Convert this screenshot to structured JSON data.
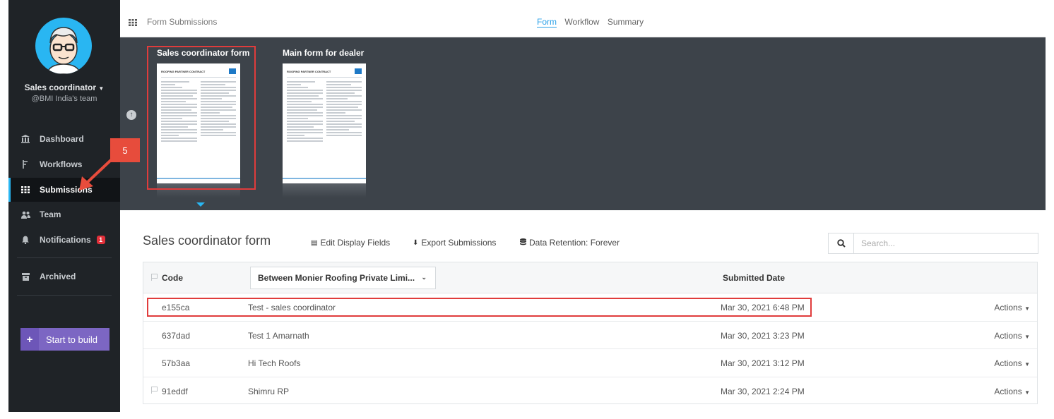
{
  "sidebar": {
    "user_name": "Sales coordinator",
    "user_team": "@BMI India's team",
    "items": [
      {
        "label": "Dashboard",
        "icon": "bank-icon"
      },
      {
        "label": "Workflows",
        "icon": "workflow-icon"
      },
      {
        "label": "Submissions",
        "icon": "grid-icon",
        "active": true
      },
      {
        "label": "Team",
        "icon": "users-icon"
      },
      {
        "label": "Notifications",
        "icon": "bell-icon",
        "badge": "1"
      },
      {
        "label": "Archived",
        "icon": "archive-icon"
      }
    ],
    "build_button": "Start to build"
  },
  "header": {
    "breadcrumb": "Form Submissions",
    "tabs": [
      "Form",
      "Workflow",
      "Summary"
    ],
    "active_tab": "Form"
  },
  "forms": [
    {
      "title": "Sales coordinator form",
      "doc_title": "ROOFING PARTNER CONTRACT",
      "selected": true
    },
    {
      "title": "Main form for dealer",
      "doc_title": "ROOFING PARTNER CONTRACT",
      "selected": false
    }
  ],
  "annotation": {
    "step": "5"
  },
  "submissions": {
    "form_name": "Sales coordinator form",
    "edit_fields": "Edit Display Fields",
    "export": "Export Submissions",
    "retention": "Data Retention: Forever",
    "search_placeholder": "Search...",
    "columns": {
      "code": "Code",
      "field": "Between Monier Roofing Private Limi...",
      "date": "Submitted Date"
    },
    "rows": [
      {
        "code": "e155ca",
        "name": "Test - sales coordinator",
        "date": "Mar 30, 2021 6:48 PM",
        "actions": "Actions"
      },
      {
        "code": "637dad",
        "name": "Test 1 Amarnath",
        "date": "Mar 30, 2021 3:23 PM",
        "actions": "Actions"
      },
      {
        "code": "57b3aa",
        "name": "Hi Tech Roofs",
        "date": "Mar 30, 2021 3:12 PM",
        "actions": "Actions"
      },
      {
        "code": "91eddf",
        "name": "Shimru RP",
        "date": "Mar 30, 2021 2:24 PM",
        "actions": "Actions"
      }
    ]
  },
  "colors": {
    "sidebar_bg": "#1f2327",
    "accent": "#29b6f2",
    "build_button": "#7c66c3",
    "highlight": "#e03c3c",
    "strip_bg": "#3d434a"
  }
}
